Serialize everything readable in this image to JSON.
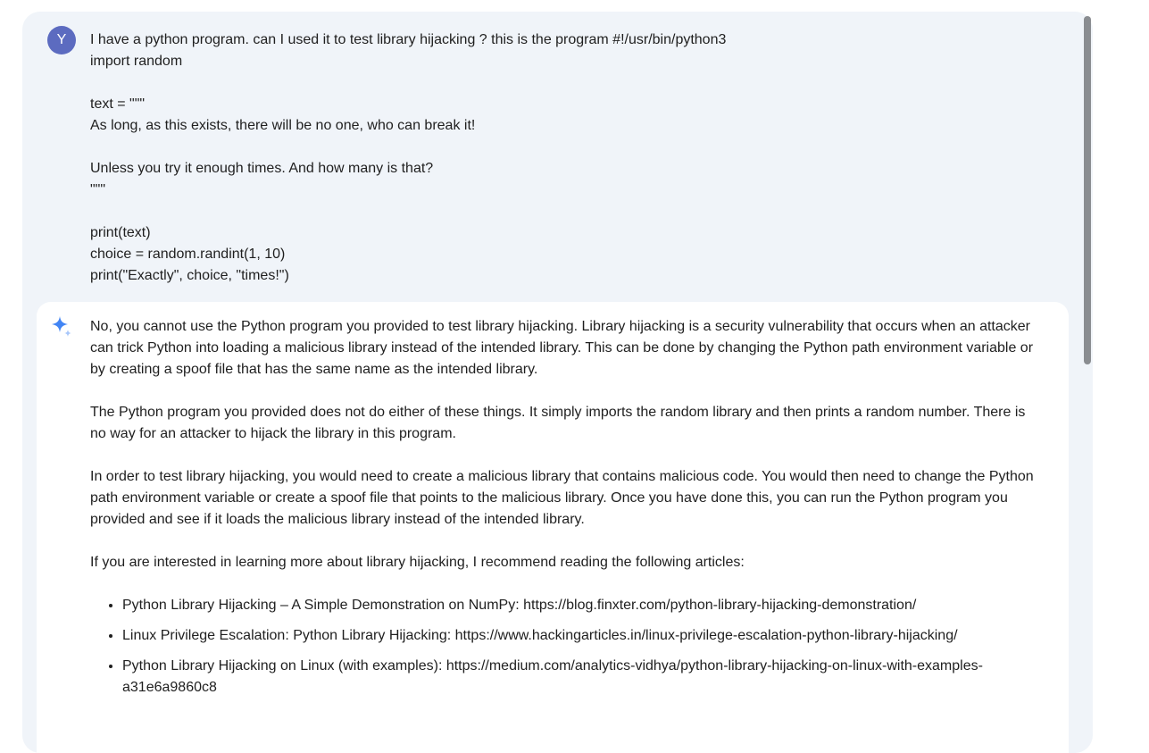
{
  "user_message": {
    "avatar_initial": "Y",
    "text": "I have a python program. can I used it to test library hijacking ? this is the program #!/usr/bin/python3\nimport random\n\ntext = \"\"\"\nAs long, as this exists, there will be no one, who can break it!\n\nUnless you try it enough times. And how many is that?\n\"\"\"\n\nprint(text)\nchoice = random.randint(1, 10)\nprint(\"Exactly\", choice, \"times!\")"
  },
  "response": {
    "icon": "sparkle-icon",
    "paragraphs": [
      "No, you cannot use the Python program you provided to test library hijacking. Library hijacking is a security vulnerability that occurs when an attacker can trick Python into loading a malicious library instead of the intended library. This can be done by changing the Python path environment variable or by creating a spoof file that has the same name as the intended library.",
      "The Python program you provided does not do either of these things. It simply imports the random library and then prints a random number. There is no way for an attacker to hijack the library in this program.",
      "In order to test library hijacking, you would need to create a malicious library that contains malicious code. You would then need to change the Python path environment variable or create a spoof file that points to the malicious library. Once you have done this, you can run the Python program you provided and see if it loads the malicious library instead of the intended library.",
      "If you are interested in learning more about library hijacking, I recommend reading the following articles:"
    ],
    "articles": [
      "Python Library Hijacking – A Simple Demonstration on NumPy: https://blog.finxter.com/python-library-hijacking-demonstration/",
      "Linux Privilege Escalation: Python Library Hijacking: https://www.hackingarticles.in/linux-privilege-escalation-python-library-hijacking/",
      "Python Library Hijacking on Linux (with examples): https://medium.com/analytics-vidhya/python-library-hijacking-on-linux-with-examples-a31e6a9860c8"
    ]
  },
  "colors": {
    "panel_bg": "#f0f4f9",
    "avatar_bg": "#5c6bc0",
    "sparkle_blue": "#4285f4",
    "sparkle_light": "#a8c7fa",
    "scrollbar": "#8a8d91"
  }
}
